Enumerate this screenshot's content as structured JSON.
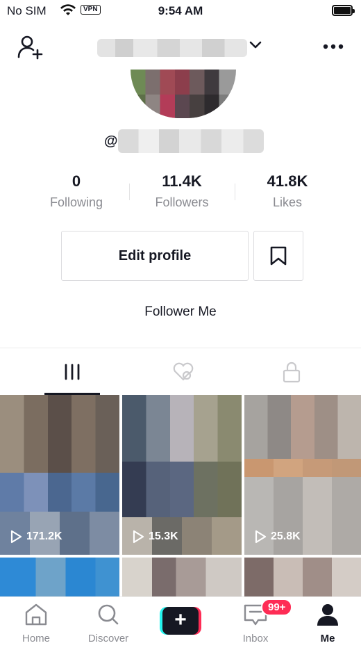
{
  "status_bar": {
    "carrier": "No SIM",
    "vpn": "VPN",
    "time": "9:54 AM"
  },
  "header": {
    "add_friend_icon": "add-user-icon",
    "more_icon": "more-icon"
  },
  "profile": {
    "handle_prefix": "@"
  },
  "stats": [
    {
      "value": "0",
      "label": "Following"
    },
    {
      "value": "11.4K",
      "label": "Followers"
    },
    {
      "value": "41.8K",
      "label": "Likes"
    }
  ],
  "actions": {
    "edit_profile": "Edit profile"
  },
  "bio": "Follower Me",
  "tabs": [
    "videos-grid-icon",
    "liked-private-icon",
    "lock-icon"
  ],
  "videos": [
    {
      "views": "171.2K"
    },
    {
      "views": "15.3K"
    },
    {
      "views": "25.8K"
    }
  ],
  "nav": {
    "items": [
      {
        "label": "Home",
        "icon": "home-icon"
      },
      {
        "label": "Discover",
        "icon": "search-icon"
      },
      {
        "label": "",
        "icon": "plus-icon"
      },
      {
        "label": "Inbox",
        "icon": "inbox-icon",
        "badge": "99+"
      },
      {
        "label": "Me",
        "icon": "profile-icon"
      }
    ]
  },
  "colors": {
    "accent_red": "#fe2c55",
    "accent_cyan": "#25f4ee",
    "text": "#161823",
    "muted": "#8a8b91"
  }
}
